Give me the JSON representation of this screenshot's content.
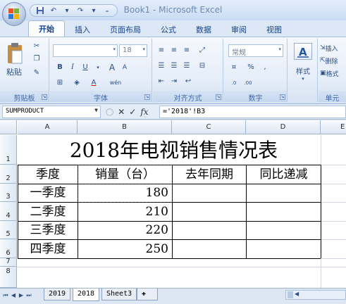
{
  "window": {
    "title": "Book1 - Microsoft Excel"
  },
  "quick_access": {
    "save_icon": "save-icon",
    "undo_icon": "undo-icon",
    "redo_icon": "redo-icon"
  },
  "tabs": [
    "开始",
    "插入",
    "页面布局",
    "公式",
    "数据",
    "审阅",
    "视图"
  ],
  "ribbon": {
    "clipboard": {
      "paste": "粘贴",
      "label": "剪贴板"
    },
    "font": {
      "size": "18",
      "bold": "B",
      "italic": "I",
      "underline": "U",
      "grow": "A",
      "shrink": "A",
      "label": "字体",
      "wen": "wén"
    },
    "alignment": {
      "label": "对齐方式"
    },
    "number": {
      "format": "常规",
      "percent": "%",
      "comma": ",",
      "label": "数字",
      "inc": ".0",
      "dec": ".00"
    },
    "styles": {
      "label": "样式"
    },
    "cells": {
      "insert": "插入",
      "delete": "删除",
      "format": "格式",
      "label": "单元"
    }
  },
  "formula_bar": {
    "name_box": "SUMPRODUCT",
    "cancel": "✕",
    "enter": "✓",
    "fx": "fx",
    "formula": "='2018'!B3"
  },
  "columns": [
    "A",
    "B",
    "C",
    "D",
    "E"
  ],
  "rows": [
    "1",
    "2",
    "3",
    "4",
    "5",
    "6",
    "7",
    "8"
  ],
  "sheet": {
    "title": "2018年电视销售情况表",
    "headers": [
      "季度",
      "销量（台）",
      "去年同期",
      "同比递减"
    ],
    "data": [
      {
        "quarter": "一季度",
        "sales": "180"
      },
      {
        "quarter": "二季度",
        "sales": "210"
      },
      {
        "quarter": "三季度",
        "sales": "220"
      },
      {
        "quarter": "四季度",
        "sales": "250"
      }
    ]
  },
  "sheet_tabs": [
    "2019",
    "2018",
    "Sheet3"
  ],
  "colors": {
    "ribbon": "#dce8f6",
    "accent": "#15428b",
    "grid_line": "#d0d7e5"
  }
}
